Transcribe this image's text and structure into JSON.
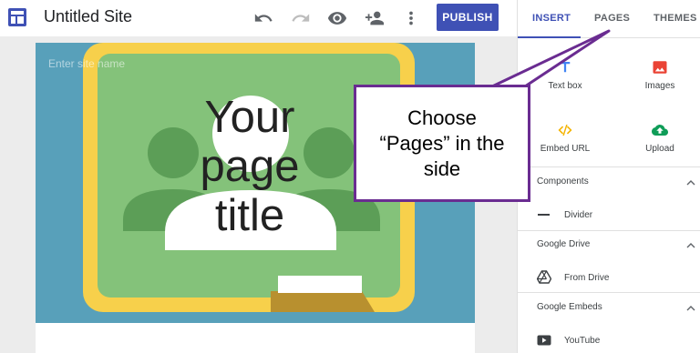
{
  "app": {
    "site_title": "Untitled Site",
    "publish_label": "PUBLISH",
    "accent_color": "#3f51b5"
  },
  "toolbar": {
    "icons": [
      "undo-icon",
      "redo-icon",
      "preview-icon",
      "share-icon",
      "more-vert-icon"
    ]
  },
  "canvas": {
    "site_name_placeholder": "Enter site name",
    "page_title_lines": [
      "Your",
      "page",
      "title"
    ]
  },
  "panel": {
    "tabs": [
      {
        "label": "INSERT",
        "active": true
      },
      {
        "label": "PAGES",
        "active": false
      },
      {
        "label": "THEMES",
        "active": false
      }
    ],
    "insert_items": [
      {
        "label": "Text box",
        "icon": "text-box-icon"
      },
      {
        "label": "Images",
        "icon": "image-icon"
      },
      {
        "label": "Embed URL",
        "icon": "embed-code-icon"
      },
      {
        "label": "Upload",
        "icon": "cloud-upload-icon"
      }
    ],
    "sections": [
      {
        "title": "Components",
        "items": [
          {
            "label": "Divider",
            "icon": "divider-icon"
          }
        ]
      },
      {
        "title": "Google Drive",
        "items": [
          {
            "label": "From Drive",
            "icon": "drive-icon"
          }
        ]
      },
      {
        "title": "Google Embeds",
        "items": [
          {
            "label": "YouTube",
            "icon": "youtube-icon"
          }
        ]
      }
    ]
  },
  "callout": {
    "text": "Choose\n“Pages” in the\nside",
    "border_color": "#6a2c91"
  }
}
